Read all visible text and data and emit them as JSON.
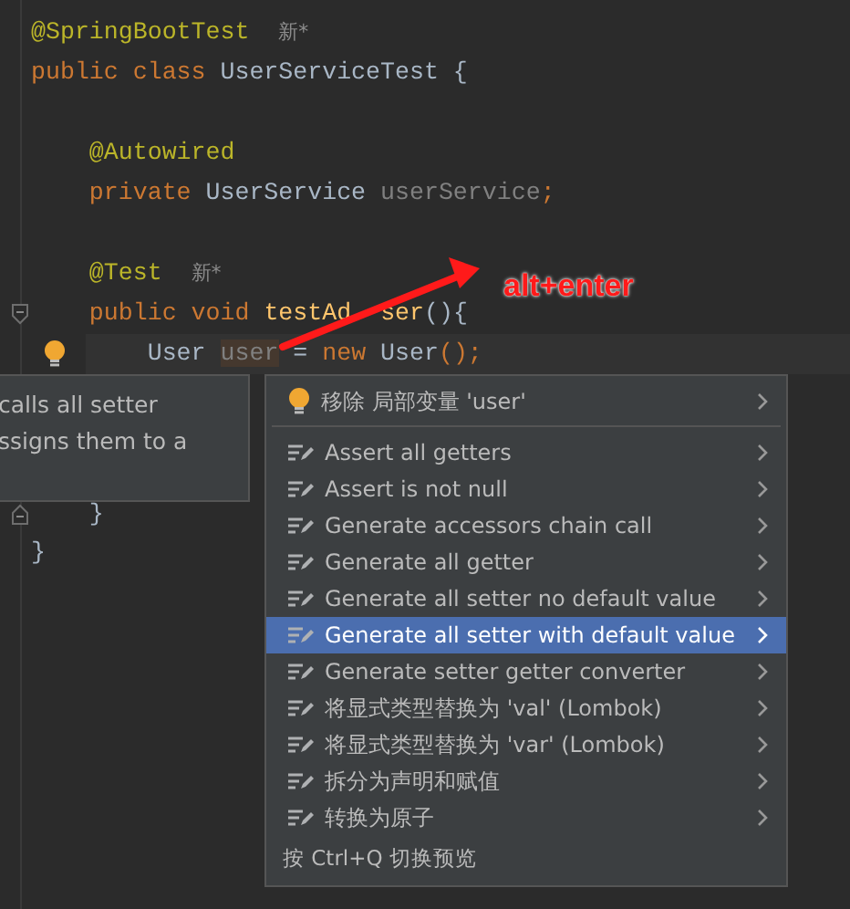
{
  "editor": {
    "lines": [
      {
        "kind": "code",
        "tokens": [
          {
            "text": "@SpringBootTest",
            "kind": "annotation"
          },
          {
            "text": "  新*",
            "kind": "hint"
          }
        ]
      },
      {
        "kind": "code",
        "tokens": [
          {
            "text": "public class ",
            "kind": "keyword"
          },
          {
            "text": "UserServiceTest {",
            "kind": "type"
          }
        ]
      },
      {
        "kind": "blank"
      },
      {
        "kind": "code",
        "tokens": [
          {
            "text": "    @Autowired",
            "kind": "annotation"
          }
        ]
      },
      {
        "kind": "code",
        "tokens": [
          {
            "text": "    private ",
            "kind": "keyword"
          },
          {
            "text": "UserService ",
            "kind": "type"
          },
          {
            "text": "userService",
            "kind": "unused"
          },
          {
            "text": ";",
            "kind": "keyword"
          }
        ]
      },
      {
        "kind": "blank"
      },
      {
        "kind": "code",
        "tokens": [
          {
            "text": "    @Test",
            "kind": "annotation"
          },
          {
            "text": "  新*",
            "kind": "hint"
          }
        ]
      },
      {
        "kind": "code",
        "fold_start": true,
        "tokens": [
          {
            "text": "    public void ",
            "kind": "keyword"
          },
          {
            "text": "testAd",
            "kind": "method"
          },
          {
            "kind": "covered"
          },
          {
            "text": "ser",
            "kind": "method"
          },
          {
            "text": "(){",
            "kind": "type"
          }
        ]
      },
      {
        "kind": "code",
        "current": true,
        "lightbulb": true,
        "tokens": [
          {
            "text": "        User ",
            "kind": "type"
          },
          {
            "text": "user",
            "kind": "unused-var"
          },
          {
            "text": " = ",
            "kind": "type"
          },
          {
            "text": "new ",
            "kind": "keyword"
          },
          {
            "text": "User",
            "kind": "type"
          },
          {
            "text": "();",
            "kind": "keyword"
          }
        ]
      },
      {
        "kind": "blank"
      },
      {
        "kind": "blank"
      },
      {
        "kind": "blank"
      },
      {
        "kind": "code",
        "fold_end": true,
        "tokens": [
          {
            "text": "    }",
            "kind": "type"
          }
        ]
      },
      {
        "kind": "code",
        "tokens": [
          {
            "text": "}",
            "kind": "type"
          }
        ]
      }
    ]
  },
  "tooltip": {
    "lines": [
      "calls all setter",
      "ssigns them to a"
    ]
  },
  "annotation": {
    "text": "alt+enter"
  },
  "popup": {
    "items": [
      {
        "label": "移除 局部变量 'user'",
        "kind": "bulb",
        "selected": false
      },
      {
        "label": "Assert all getters",
        "kind": "intention",
        "selected": false
      },
      {
        "label": "Assert is not null",
        "kind": "intention",
        "selected": false
      },
      {
        "label": "Generate accessors chain call",
        "kind": "intention",
        "selected": false
      },
      {
        "label": "Generate all getter",
        "kind": "intention",
        "selected": false
      },
      {
        "label": "Generate all setter no default value",
        "kind": "intention",
        "selected": false
      },
      {
        "label": "Generate all setter with default value",
        "kind": "intention",
        "selected": true
      },
      {
        "label": "Generate setter getter converter",
        "kind": "intention",
        "selected": false
      },
      {
        "label": "将显式类型替换为 'val' (Lombok)",
        "kind": "intention",
        "selected": false
      },
      {
        "label": "将显式类型替换为 'var' (Lombok)",
        "kind": "intention",
        "selected": false
      },
      {
        "label": "拆分为声明和赋值",
        "kind": "intention",
        "selected": false
      },
      {
        "label": "转换为原子",
        "kind": "intention",
        "selected": false
      }
    ],
    "footer": "按 Ctrl+Q 切换预览"
  }
}
